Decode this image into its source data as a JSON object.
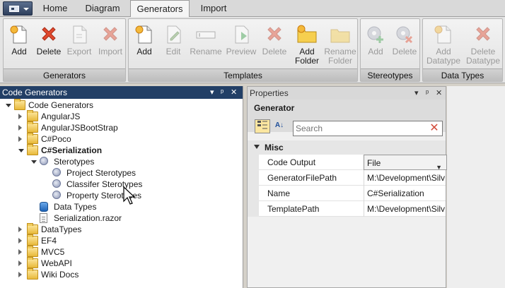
{
  "tabs": [
    "Home",
    "Diagram",
    "Generators",
    "Import"
  ],
  "active_tab": "Generators",
  "ribbon": {
    "groups": [
      {
        "label": "Generators",
        "buttons": [
          {
            "label": "Add",
            "icon": "add-doc-icon",
            "enabled": true
          },
          {
            "label": "Delete",
            "icon": "red-x-icon",
            "enabled": true
          },
          {
            "label": "Export",
            "icon": "export-doc-icon",
            "enabled": false
          },
          {
            "label": "Import",
            "icon": "red-x-icon",
            "enabled": false
          }
        ]
      },
      {
        "label": "Templates",
        "buttons": [
          {
            "label": "Add",
            "icon": "add-doc-icon",
            "enabled": true
          },
          {
            "label": "Edit",
            "icon": "edit-icon",
            "enabled": false
          },
          {
            "label": "Rename",
            "icon": "rename-icon",
            "enabled": false
          },
          {
            "label": "Preview",
            "icon": "preview-icon",
            "enabled": false
          },
          {
            "label": "Delete",
            "icon": "red-x-icon",
            "enabled": false
          },
          {
            "label": "Add\nFolder",
            "icon": "add-folder-icon",
            "enabled": true
          },
          {
            "label": "Rename\nFolder",
            "icon": "rename-folder-icon",
            "enabled": false
          }
        ]
      },
      {
        "label": "Stereotypes",
        "buttons": [
          {
            "label": "Add",
            "icon": "gear-add-icon",
            "enabled": false
          },
          {
            "label": "Delete",
            "icon": "gear-delete-icon",
            "enabled": false
          }
        ]
      },
      {
        "label": "Data Types",
        "buttons": [
          {
            "label": "Add\nDatatype",
            "icon": "add-doc-icon",
            "enabled": false
          },
          {
            "label": "Delete\nDatatype",
            "icon": "red-x-icon",
            "enabled": false
          }
        ]
      }
    ]
  },
  "code_generators_panel": {
    "title": "Code Generators",
    "controls": [
      "▾",
      "ᵖ",
      "✕"
    ],
    "tree": [
      {
        "label": "Code Generators",
        "icon": "folder-icon",
        "expander": "open",
        "depth": 0
      },
      {
        "label": "AngularJS",
        "icon": "folder-icon",
        "expander": "closed",
        "depth": 1
      },
      {
        "label": "AngularJSBootStrap",
        "icon": "folder-icon",
        "expander": "closed",
        "depth": 1
      },
      {
        "label": "C#Poco",
        "icon": "folder-icon",
        "expander": "closed",
        "depth": 1
      },
      {
        "label": "C#Serialization",
        "icon": "folder-icon",
        "expander": "open",
        "depth": 1,
        "bold": true
      },
      {
        "label": "Sterotypes",
        "icon": "gears-icon",
        "expander": "open",
        "depth": 2
      },
      {
        "label": "Project Sterotypes",
        "icon": "gears-icon",
        "expander": "none",
        "depth": 3
      },
      {
        "label": "Classifer Sterotypes",
        "icon": "gears-icon",
        "expander": "none",
        "depth": 3
      },
      {
        "label": "Property Sterotypes",
        "icon": "gears-icon",
        "expander": "none",
        "depth": 3
      },
      {
        "label": "Data Types",
        "icon": "database-icon",
        "expander": "none",
        "depth": 2
      },
      {
        "label": "Serialization.razor",
        "icon": "file-icon",
        "expander": "none",
        "depth": 2
      },
      {
        "label": "DataTypes",
        "icon": "folder-icon",
        "expander": "closed",
        "depth": 1
      },
      {
        "label": "EF4",
        "icon": "folder-icon",
        "expander": "closed",
        "depth": 1
      },
      {
        "label": "MVC5",
        "icon": "folder-icon",
        "expander": "closed",
        "depth": 1
      },
      {
        "label": "WebAPI",
        "icon": "folder-icon",
        "expander": "closed",
        "depth": 1
      },
      {
        "label": "Wiki Docs",
        "icon": "folder-icon",
        "expander": "closed",
        "depth": 1
      }
    ]
  },
  "properties_panel": {
    "title": "Properties",
    "controls": [
      "▾",
      "ᵖ",
      "✕"
    ],
    "object_name": "Generator",
    "toolbar": [
      "categorized-icon",
      "alphabetical-icon"
    ],
    "search_placeholder": "Search",
    "category": "Misc",
    "rows": [
      {
        "name": "Code Output",
        "value": "File",
        "dropdown": true
      },
      {
        "name": "GeneratorFilePath",
        "value": "M:\\Development\\Silv"
      },
      {
        "name": "Name",
        "value": "C#Serialization"
      },
      {
        "name": "TemplatePath",
        "value": "M:\\Development\\Silv"
      }
    ]
  }
}
